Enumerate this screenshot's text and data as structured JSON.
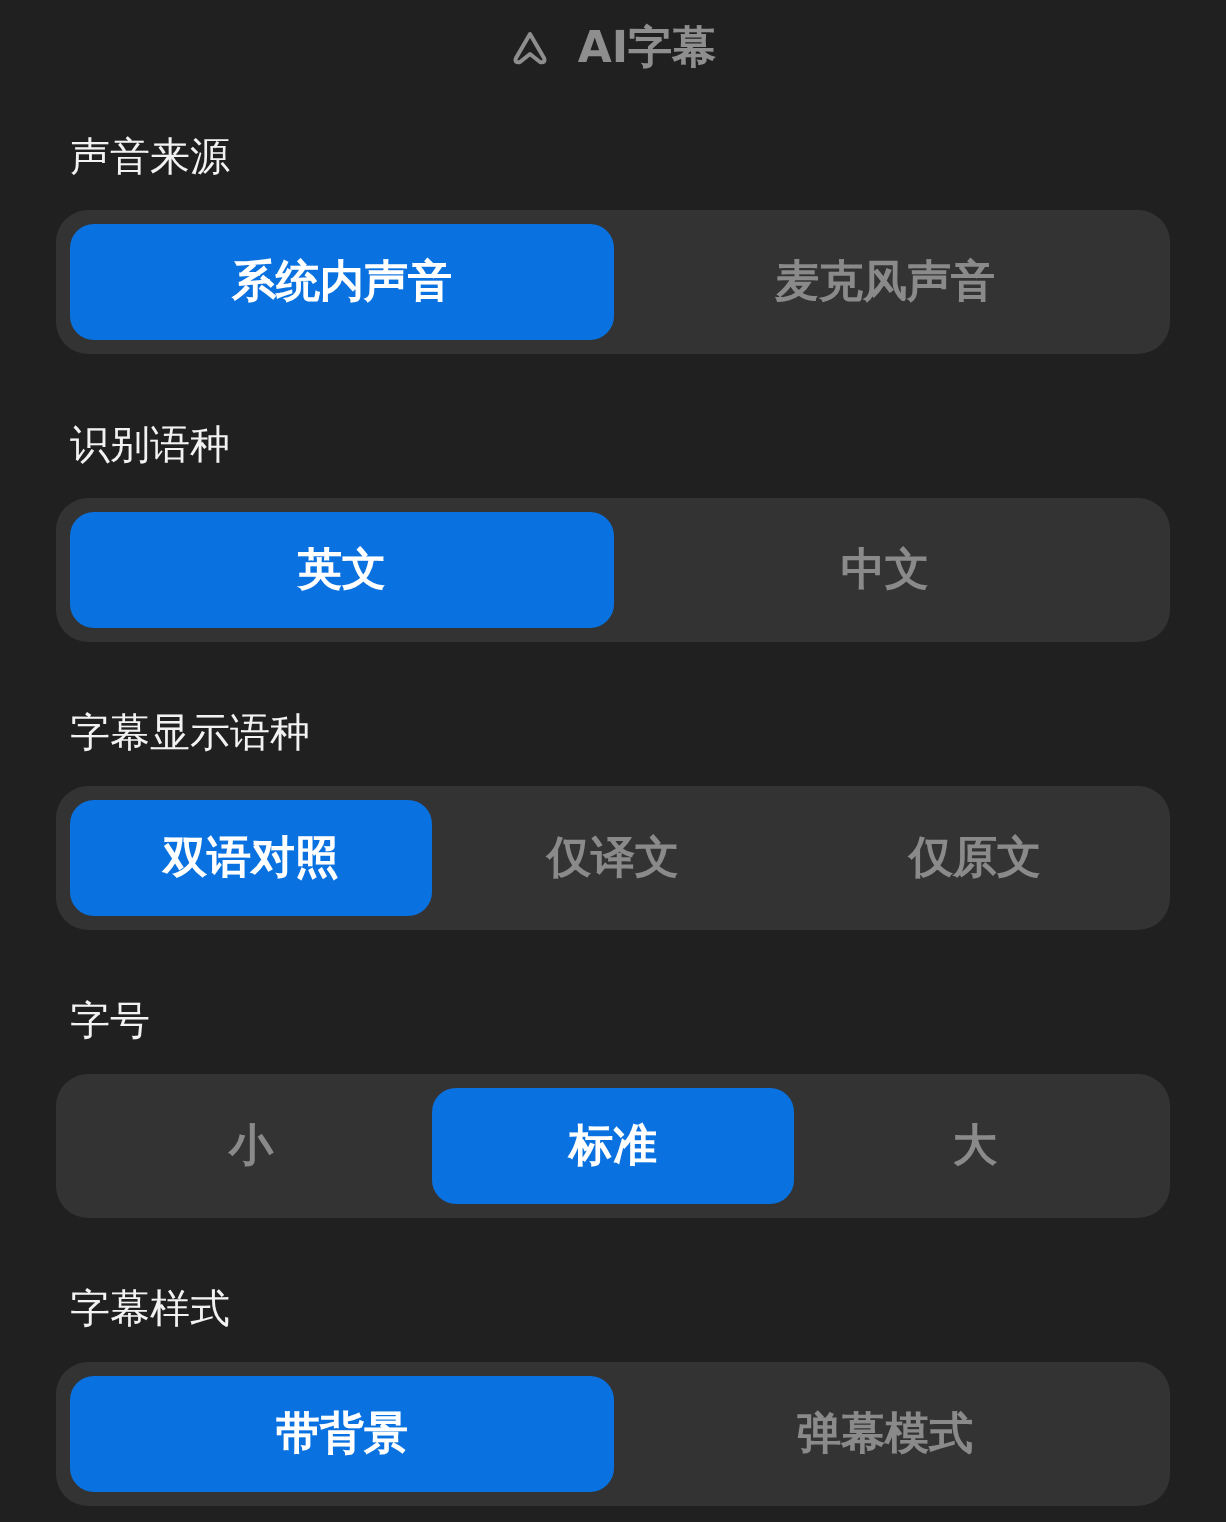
{
  "header": {
    "title": "AI字幕"
  },
  "sections": [
    {
      "label": "声音来源",
      "options": [
        {
          "label": "系统内声音",
          "selected": true
        },
        {
          "label": "麦克风声音",
          "selected": false
        }
      ]
    },
    {
      "label": "识别语种",
      "options": [
        {
          "label": "英文",
          "selected": true
        },
        {
          "label": "中文",
          "selected": false
        }
      ]
    },
    {
      "label": "字幕显示语种",
      "options": [
        {
          "label": "双语对照",
          "selected": true
        },
        {
          "label": "仅译文",
          "selected": false
        },
        {
          "label": "仅原文",
          "selected": false
        }
      ]
    },
    {
      "label": "字号",
      "options": [
        {
          "label": "小",
          "selected": false
        },
        {
          "label": "标准",
          "selected": true
        },
        {
          "label": "大",
          "selected": false
        }
      ]
    },
    {
      "label": "字幕样式",
      "options": [
        {
          "label": "带背景",
          "selected": true
        },
        {
          "label": "弹幕模式",
          "selected": false
        }
      ]
    }
  ]
}
